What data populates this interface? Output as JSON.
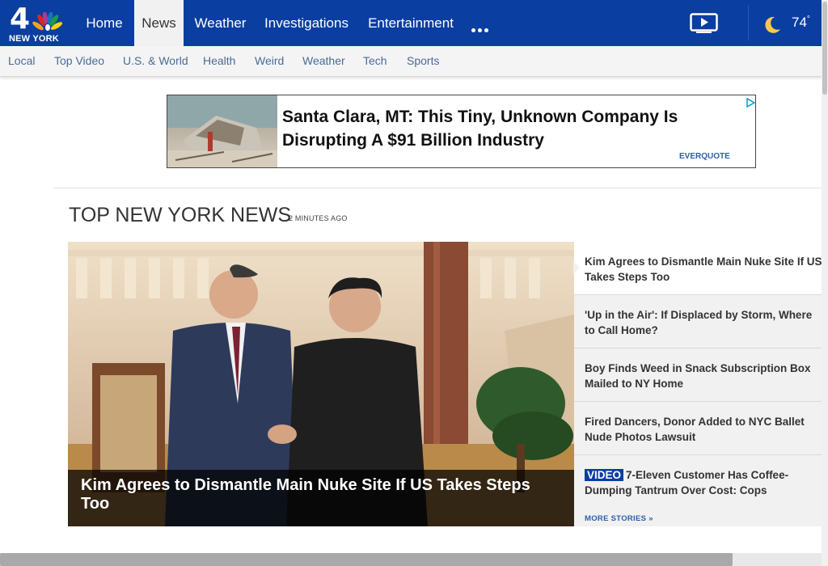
{
  "brand": {
    "number": "4",
    "city": "NEW YORK"
  },
  "nav": {
    "items": [
      {
        "label": "Home"
      },
      {
        "label": "News",
        "active": true
      },
      {
        "label": "Weather"
      },
      {
        "label": "Investigations"
      },
      {
        "label": "Entertainment"
      }
    ]
  },
  "weather": {
    "temperature": "74",
    "degree": "°",
    "icon": "moon-icon"
  },
  "subnav": {
    "items": [
      "Local",
      "Top Video",
      "U.S. & World",
      "Health",
      "Weird",
      "Weather",
      "Tech",
      "Sports"
    ]
  },
  "ad": {
    "headline": "Santa Clara, MT: This Tiny, Unknown Company Is Disrupting A $91 Billion Industry",
    "brand": "EVERQUOTE"
  },
  "section": {
    "title": "TOP NEW YORK NEWS",
    "updated": "2 MINUTES AGO"
  },
  "hero": {
    "headline": "Kim Agrees to Dismantle Main Nuke Site If US Takes Steps Too"
  },
  "stories": [
    {
      "title": "Kim Agrees to Dismantle Main Nuke Site If US Takes Steps Too"
    },
    {
      "title": "'Up in the Air': If Displaced by Storm, Where to Call Home?"
    },
    {
      "title": "Boy Finds Weed in Snack Subscription Box Mailed to NY Home"
    },
    {
      "title": "Fired Dancers, Donor Added to NYC Ballet Nude Photos Lawsuit"
    },
    {
      "tag": "VIDEO",
      "title": "7-Eleven Customer Has Coffee-Dumping Tantrum Over Cost: Cops"
    }
  ],
  "more_stories": "MORE STORIES »",
  "colors": {
    "brand_blue": "#0b3ea1",
    "link_blue": "#2b5fa8"
  }
}
